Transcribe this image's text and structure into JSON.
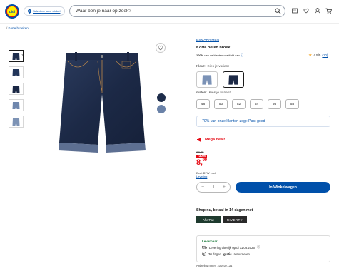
{
  "header": {
    "logo_text": "Lidl",
    "store_selector": "Selecteer jouw winkel",
    "search_placeholder": "Waar ben je naar op zoek?",
    "icons": [
      "menu-icon",
      "heart-icon",
      "user-icon",
      "cart-icon"
    ]
  },
  "breadcrumb": {
    "prefix": "... /",
    "current": "Korte broeken"
  },
  "gallery": {
    "thumb_count_label": "1",
    "thumbnails": [
      "thumb-1",
      "thumb-2",
      "thumb-3",
      "thumb-4",
      "thumb-5"
    ],
    "color_dots": [
      "#1d2c4a",
      "#6a82a8"
    ]
  },
  "product": {
    "brand": "ESMARA MEN",
    "title": "Korte heren broek",
    "recommend_pct": "100%",
    "recommend_text": "van de klanten raadt dit aan",
    "rating": "4.5/5",
    "review_count": "(10)",
    "color_label": "Kleur:",
    "color_hint": "Kies je variant",
    "size_label": "maten:",
    "size_hint": "Kies je variant",
    "sizes": [
      "48",
      "50",
      "52",
      "54",
      "56",
      "58"
    ],
    "fit_text": "70% van onze klanten zegt: Past goed"
  },
  "pricing": {
    "badge": "Mega deal!",
    "old_price": "12.99",
    "discount": "-30%",
    "price_main": "8,",
    "price_cents": "99",
    "vat_line": "Excl. BTW excl.",
    "levering": "Levering"
  },
  "cart": {
    "qty_minus": "−",
    "qty_value": "1",
    "qty_plus": "+",
    "add_label": "In Winkelwagen"
  },
  "payment": {
    "heading": "Shop nu, betaal in 14 dagen met",
    "logos": [
      "AfterPay",
      "RIVERTY"
    ]
  },
  "delivery": {
    "status": "Leverbaar",
    "line1": "Levering uiterlijk op di 11.08.2026",
    "line2_prefix": "30 dagen",
    "line2_bold": "gratis",
    "line2_suffix": "retourneren"
  },
  "article_number": "Artikelnummer: 100407134",
  "colors": {
    "brand_blue": "#0050aa",
    "sale_red": "#e60a14",
    "lidl_yellow": "#fff100"
  }
}
